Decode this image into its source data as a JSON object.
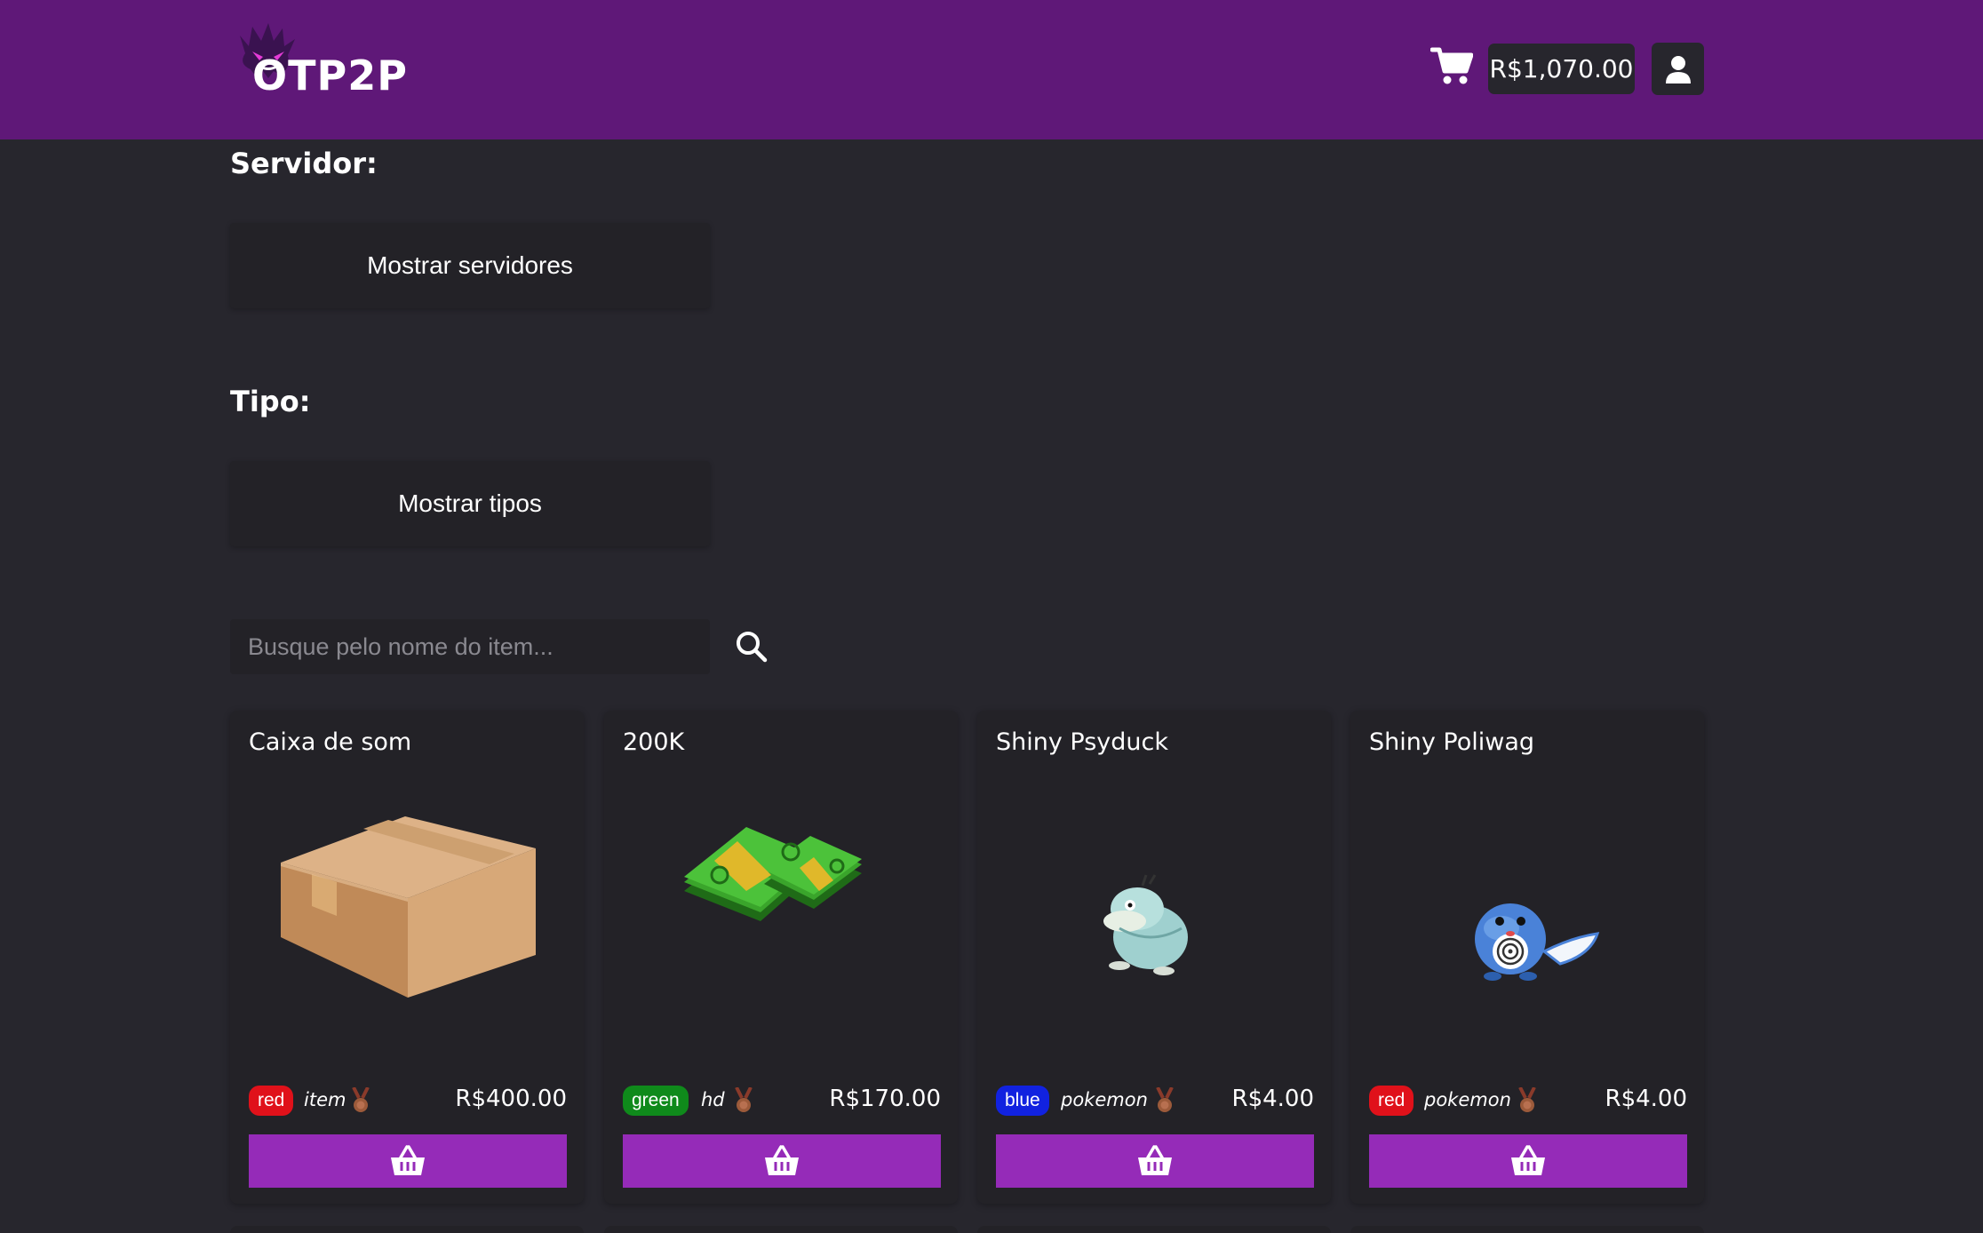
{
  "header": {
    "logo_text": "OTP2P",
    "balance": "R$1,070.00"
  },
  "filters": {
    "server_label": "Servidor:",
    "server_button": "Mostrar servidores",
    "type_label": "Tipo:",
    "type_button": "Mostrar tipos"
  },
  "search": {
    "placeholder": "Busque pelo nome do item..."
  },
  "colors": {
    "header_bg": "#5f1878",
    "page_bg": "#27262d",
    "card_bg": "#232227",
    "buy_button": "#952bb8",
    "badge_red": "#e0111a",
    "badge_green": "#0f8a1b",
    "badge_blue": "#1122e0"
  },
  "icons": {
    "cart": "shopping-cart-icon",
    "user": "user-icon",
    "search": "magnifier-icon",
    "medal": "medal-icon",
    "buy": "basket-icon"
  },
  "products": [
    {
      "title": "Caixa de som",
      "badge": "red",
      "category": "item",
      "price": "R$400.00",
      "image": "cardboard-box"
    },
    {
      "title": "200K",
      "badge": "green",
      "category": "hd",
      "price": "R$170.00",
      "image": "money-stack"
    },
    {
      "title": "Shiny Psyduck",
      "badge": "blue",
      "category": "pokemon",
      "price": "R$4.00",
      "image": "psyduck-sprite"
    },
    {
      "title": "Shiny Poliwag",
      "badge": "red",
      "category": "pokemon",
      "price": "R$4.00",
      "image": "poliwag-sprite"
    }
  ]
}
